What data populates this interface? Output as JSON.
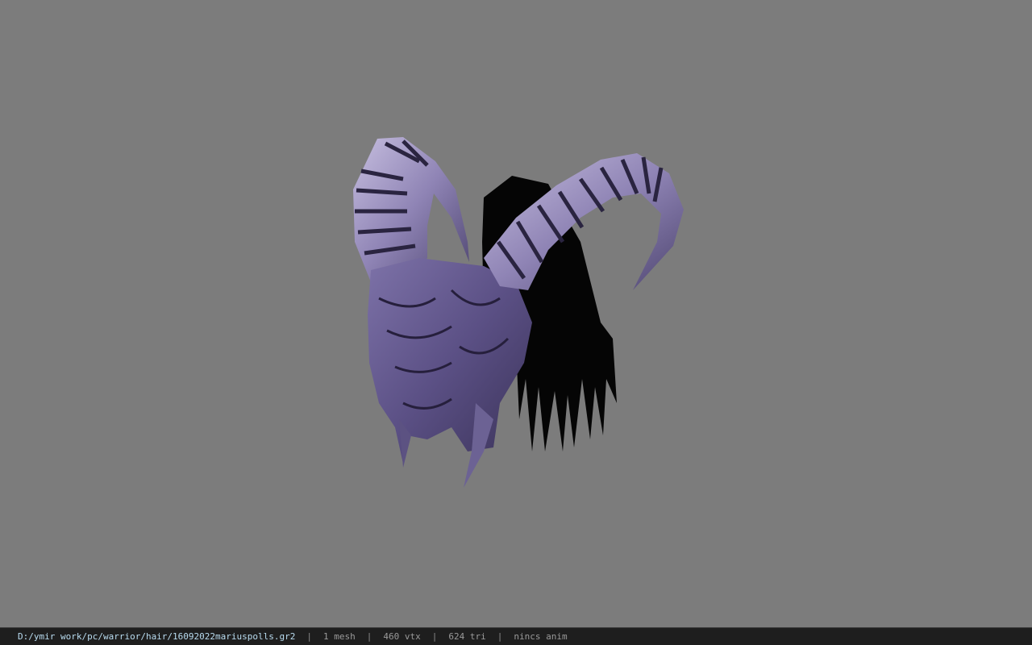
{
  "viewer": {
    "background_color": "#7c7c7c",
    "model": {
      "icon": "horned-helmet-hair-model",
      "horn_color": "#9a8fbf",
      "hair_color": "#050505"
    }
  },
  "statusbar": {
    "file_path": "D:/ymir work/pc/warrior/hair/16092022mariuspolls.gr2",
    "separator": "|",
    "mesh_count": "1 mesh",
    "vertex_count": "460 vtx",
    "triangle_count": "624 tri",
    "animation": "nincs anim"
  }
}
